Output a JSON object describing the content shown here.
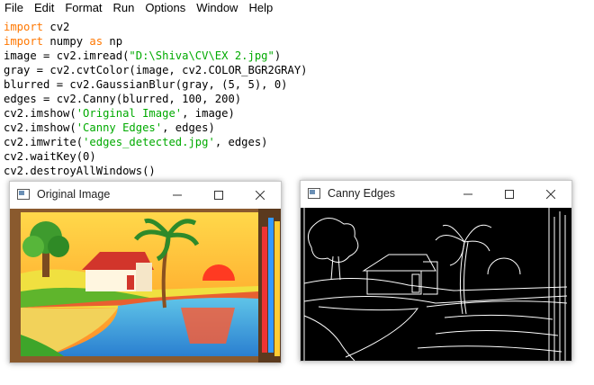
{
  "menu": [
    "File",
    "Edit",
    "Format",
    "Run",
    "Options",
    "Window",
    "Help"
  ],
  "code_lines": [
    [
      {
        "t": "import",
        "c": "kw"
      },
      {
        "t": " cv2"
      }
    ],
    [
      {
        "t": "import",
        "c": "kw"
      },
      {
        "t": " numpy "
      },
      {
        "t": "as",
        "c": "kw"
      },
      {
        "t": " np"
      }
    ],
    [
      {
        "t": "image = cv2.imread("
      },
      {
        "t": "\"D:\\Shiva\\CV\\EX 2.jpg\"",
        "c": "str"
      },
      {
        "t": ")"
      }
    ],
    [
      {
        "t": "gray = cv2.cvtColor(image, cv2.COLOR_BGR2GRAY)"
      }
    ],
    [
      {
        "t": "blurred = cv2.GaussianBlur(gray, (5, 5), 0)"
      }
    ],
    [
      {
        "t": "edges = cv2.Canny(blurred, 100, 200)"
      }
    ],
    [
      {
        "t": "cv2.imshow("
      },
      {
        "t": "'Original Image'",
        "c": "str"
      },
      {
        "t": ", image)"
      }
    ],
    [
      {
        "t": "cv2.imshow("
      },
      {
        "t": "'Canny Edges'",
        "c": "str"
      },
      {
        "t": ", edges)"
      }
    ],
    [
      {
        "t": "cv2.imwrite("
      },
      {
        "t": "'edges_detected.jpg'",
        "c": "str"
      },
      {
        "t": ", edges)"
      }
    ],
    [
      {
        "t": "cv2.waitKey(0)"
      }
    ],
    [
      {
        "t": "cv2.destroyAllWindows()"
      }
    ]
  ],
  "windows": {
    "original": {
      "title": "Original Image"
    },
    "edges": {
      "title": "Canny Edges"
    }
  },
  "icons": {
    "app": "window-app-icon",
    "minimize": "minimize-icon",
    "maximize": "maximize-icon",
    "close": "close-icon"
  },
  "colors": {
    "keyword": "#ff7700",
    "string": "#00aa00",
    "text": "#000000"
  }
}
